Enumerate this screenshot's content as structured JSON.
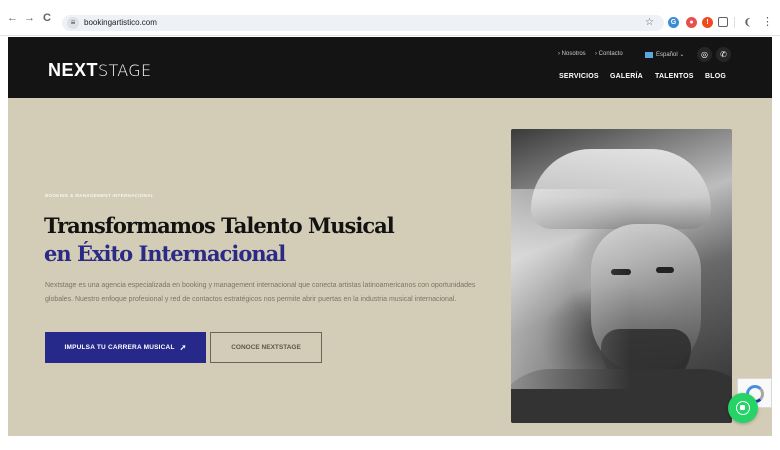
{
  "browser": {
    "url": "bookingartistico.com",
    "back_glyph": "←",
    "forward_glyph": "→",
    "reload_glyph": "C",
    "tune_glyph": "≡",
    "star_glyph": "☆",
    "menu_glyph": "⋮"
  },
  "header": {
    "logo_bold": "NEXT",
    "logo_light": "STAGE",
    "top_links": [
      "› Nosotros",
      "› Contacto"
    ],
    "language": "Español ⌄",
    "social": [
      "instagram-icon",
      "whatsapp-icon"
    ],
    "nav": [
      "SERVICIOS",
      "GALERÍA",
      "TALENTOS",
      "BLOG"
    ]
  },
  "hero": {
    "eyebrow": "BOOKING & MANAGEMENT INTERNACIONAL",
    "title_line1": "Transformamos Talento Musical",
    "title_line2": "en Éxito Internacional",
    "description": "Nextstage es una agencia especializada en booking y management internacional que conecta artistas latinoamericanos con oportunidades globales. Nuestro enfoque profesional y red de contactos estratégicos nos permite abrir puertas en la industria musical internacional.",
    "primary_cta": "IMPULSA TU CARRERA MUSICAL",
    "primary_cta_icon": "rocket-icon",
    "secondary_cta": "CONOCE NEXTSTAGE"
  },
  "colors": {
    "header_bg": "#141414",
    "hero_bg": "#d3ccb6",
    "accent": "#27298a",
    "whatsapp": "#25d366"
  }
}
